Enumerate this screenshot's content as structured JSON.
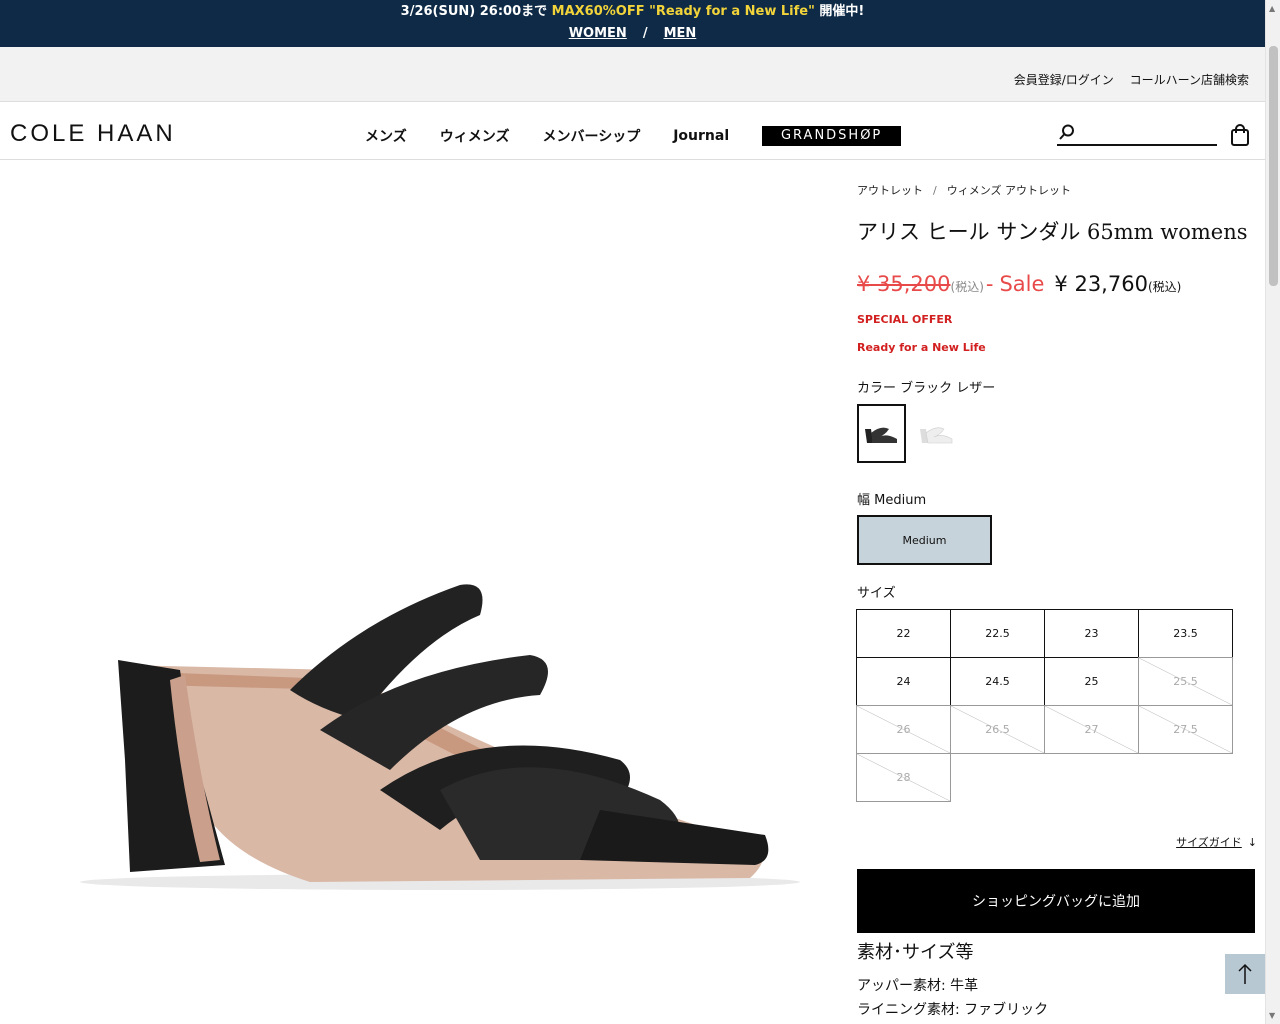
{
  "promo": {
    "prefix": "3/26(SUN) 26:00まで ",
    "highlight": "MAX60%OFF \"Ready for a New Life\"",
    "suffix": " 開催中!",
    "women": "WOMEN",
    "sep": "/",
    "men": "MEN"
  },
  "util": {
    "login": "会員登録/ログイン",
    "store": "コールハーン店舗検索"
  },
  "header": {
    "logo": "COLE HAAN",
    "nav": [
      "メンズ",
      "ウィメンズ",
      "メンバーシップ",
      "Journal"
    ],
    "grandshop": "GRANDSHØP"
  },
  "breadcrumb": [
    "アウトレット",
    "ウィメンズ アウトレット"
  ],
  "breadcrumb_sep": "/",
  "product": {
    "title": "アリス ヒール サンダル 65mm womens",
    "old_price": "¥ 35,200",
    "tax_note": "(税込)",
    "dash": "-",
    "sale_label": "Sale",
    "new_price": "¥ 23,760",
    "special": "SPECIAL OFFER",
    "campaign": "Ready for a New Life",
    "color_label": "カラー ブラック レザー",
    "width_label": "幅 Medium",
    "width_option": "Medium",
    "size_label": "サイズ",
    "sizes": [
      {
        "label": "22",
        "available": true
      },
      {
        "label": "22.5",
        "available": true
      },
      {
        "label": "23",
        "available": true
      },
      {
        "label": "23.5",
        "available": true
      },
      {
        "label": "24",
        "available": true
      },
      {
        "label": "24.5",
        "available": true
      },
      {
        "label": "25",
        "available": true
      },
      {
        "label": "25.5",
        "available": false
      },
      {
        "label": "26",
        "available": false
      },
      {
        "label": "26.5",
        "available": false
      },
      {
        "label": "27",
        "available": false
      },
      {
        "label": "27.5",
        "available": false
      },
      {
        "label": "28",
        "available": false
      }
    ],
    "size_guide": "サイズガイド",
    "add_to_bag": "ショッピングバッグに追加",
    "material_title": "素材･サイズ等",
    "upper_material": "アッパー素材: 牛革",
    "lining_material": "ライニング素材: ファブリック"
  },
  "colors": {
    "banner_bg": "#0e2a47",
    "highlight": "#f2d43a",
    "sale_red": "#e84a4a",
    "offer_red": "#d21f1f",
    "width_selected": "#c7d3da"
  }
}
